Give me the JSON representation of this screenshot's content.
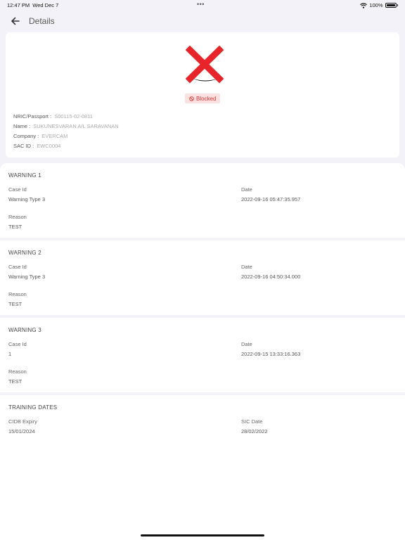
{
  "status_bar": {
    "time": "12:47 PM",
    "date": "Wed Dec 7",
    "dots": "•••",
    "battery": "100%"
  },
  "header": {
    "title": "Details"
  },
  "profile": {
    "status": "Blocked",
    "fields": [
      {
        "label": "NRIC/Passport :",
        "value": "S00115-02-0811"
      },
      {
        "label": "Name :",
        "value": "SUKUNESVARAN A/L SARAVANAN"
      },
      {
        "label": "Company :",
        "value": "EVERCAM"
      },
      {
        "label": "SAC ID :",
        "value": "EWC0004"
      }
    ]
  },
  "warnings": [
    {
      "title": "WARNING 1",
      "case_id_label": "Case Id",
      "case_id": "Warning Type 3",
      "date_label": "Date",
      "date": "2022-09-16 05:47:35.957",
      "reason_label": "Reason",
      "reason": "TEST"
    },
    {
      "title": "WARNING 2",
      "case_id_label": "Case Id",
      "case_id": "Warning Type 3",
      "date_label": "Date",
      "date": "2022-09-16 04:50:34.000",
      "reason_label": "Reason",
      "reason": "TEST"
    },
    {
      "title": "WARNING 3",
      "case_id_label": "Case Id",
      "case_id": "1",
      "date_label": "Date",
      "date": "2022-09-15 13:33:16.363",
      "reason_label": "Reason",
      "reason": "TEST"
    }
  ],
  "training": {
    "title": "TRAINING DATES",
    "cidb_label": "CIDB Expiry",
    "cidb_value": "15/01/2024",
    "sic_label": "SIC Date",
    "sic_value": "28/02/2022"
  },
  "colors": {
    "blocked_bg": "#fde0e0",
    "blocked_text": "#dd3333",
    "x_red": "#e8242b"
  }
}
